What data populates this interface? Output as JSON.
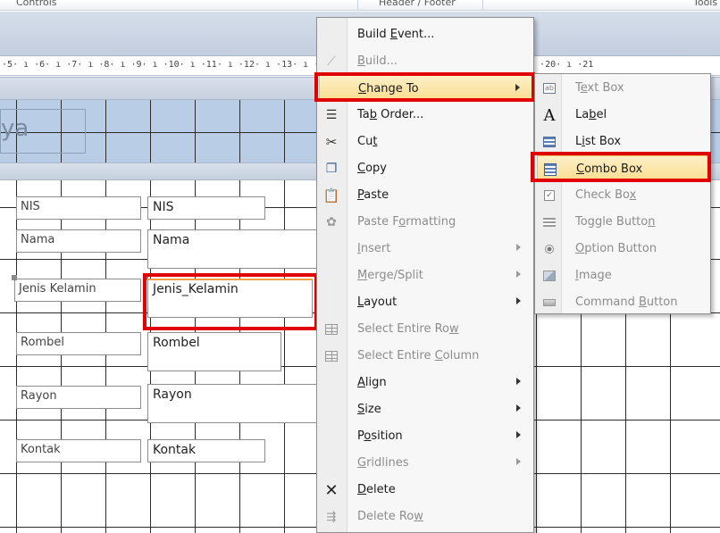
{
  "ribbon": {
    "groups": [
      "Controls",
      "Header / Footer",
      "Tools"
    ]
  },
  "ruler": {
    "text": "·5· ı ·6· ı ·7· ı ·8· ı ·9· ı ·10· ı ·11· ı ·12· ı ·13· ı ·14· ı ·15· ı ·16· ı ·17· ı ·18· ı ·19· ı ·20· ı ·21"
  },
  "header": {
    "title_fragment": "ya"
  },
  "form": {
    "labels": [
      "NIS",
      "Nama",
      "Jenis Kelamin",
      "Rombel",
      "Rayon",
      "Kontak"
    ],
    "fields": [
      "NIS",
      "Nama",
      "Jenis_Kelamin",
      "Rombel",
      "Rayon",
      "Kontak"
    ]
  },
  "context_menu": {
    "items": [
      {
        "pre": "Build ",
        "key": "E",
        "post": "vent...",
        "icon": "none",
        "disabled": false,
        "submenu": false
      },
      {
        "pre": "",
        "key": "B",
        "post": "uild...",
        "icon": "wand-icon",
        "disabled": true,
        "submenu": false
      },
      {
        "pre": "",
        "key": "C",
        "post": "hange To",
        "icon": "none",
        "disabled": false,
        "submenu": true
      },
      {
        "pre": "Ta",
        "key": "b",
        "post": " Order...",
        "icon": "tab-order-icon",
        "disabled": false,
        "submenu": false
      },
      {
        "pre": "Cu",
        "key": "t",
        "post": "",
        "icon": "scissors-icon",
        "disabled": false,
        "submenu": false
      },
      {
        "pre": "",
        "key": "C",
        "post": "opy",
        "icon": "copy-icon",
        "disabled": false,
        "submenu": false
      },
      {
        "pre": "",
        "key": "P",
        "post": "aste",
        "icon": "paste-icon",
        "disabled": false,
        "submenu": false
      },
      {
        "pre": "Paste F",
        "key": "o",
        "post": "rmatting",
        "icon": "paste-formatting-icon",
        "disabled": true,
        "submenu": false
      },
      {
        "pre": "",
        "key": "I",
        "post": "nsert",
        "icon": "none",
        "disabled": true,
        "submenu": true
      },
      {
        "pre": "",
        "key": "M",
        "post": "erge/Split",
        "icon": "none",
        "disabled": true,
        "submenu": true
      },
      {
        "pre": "",
        "key": "L",
        "post": "ayout",
        "icon": "none",
        "disabled": false,
        "submenu": true
      },
      {
        "pre": "Select Entire Ro",
        "key": "w",
        "post": "",
        "icon": "select-row-icon",
        "disabled": true,
        "submenu": false
      },
      {
        "pre": "Select Entire ",
        "key": "C",
        "post": "olumn",
        "icon": "select-column-icon",
        "disabled": true,
        "submenu": false
      },
      {
        "pre": "",
        "key": "A",
        "post": "lign",
        "icon": "none",
        "disabled": false,
        "submenu": true
      },
      {
        "pre": "",
        "key": "S",
        "post": "ize",
        "icon": "none",
        "disabled": false,
        "submenu": true
      },
      {
        "pre": "P",
        "key": "o",
        "post": "sition",
        "icon": "none",
        "disabled": false,
        "submenu": true
      },
      {
        "pre": "",
        "key": "G",
        "post": "ridlines",
        "icon": "none",
        "disabled": true,
        "submenu": true
      },
      {
        "pre": "",
        "key": "D",
        "post": "elete",
        "icon": "delete-icon",
        "disabled": false,
        "submenu": false
      },
      {
        "pre": "Delete Ro",
        "key": "w",
        "post": "",
        "icon": "delete-row-icon",
        "disabled": true,
        "submenu": false
      }
    ]
  },
  "submenu": {
    "items": [
      {
        "pre": "T",
        "key": "e",
        "post": "xt Box",
        "icon": "text-box-icon",
        "disabled": true
      },
      {
        "pre": "La",
        "key": "b",
        "post": "el",
        "icon": "label-icon",
        "disabled": false
      },
      {
        "pre": "L",
        "key": "i",
        "post": "st Box",
        "icon": "list-box-icon",
        "disabled": false
      },
      {
        "pre": "",
        "key": "C",
        "post": "ombo Box",
        "icon": "combo-box-icon",
        "disabled": false
      },
      {
        "pre": "Check Bo",
        "key": "x",
        "post": "",
        "icon": "check-box-icon",
        "disabled": true
      },
      {
        "pre": "Toggle Butto",
        "key": "n",
        "post": "",
        "icon": "toggle-button-icon",
        "disabled": true
      },
      {
        "pre": "",
        "key": "O",
        "post": "ption Button",
        "icon": "option-button-icon",
        "disabled": true
      },
      {
        "pre": "",
        "key": "I",
        "post": "mage",
        "icon": "image-icon",
        "disabled": true
      },
      {
        "pre": "Command ",
        "key": "B",
        "post": "utton",
        "icon": "command-button-icon",
        "disabled": true
      }
    ]
  }
}
